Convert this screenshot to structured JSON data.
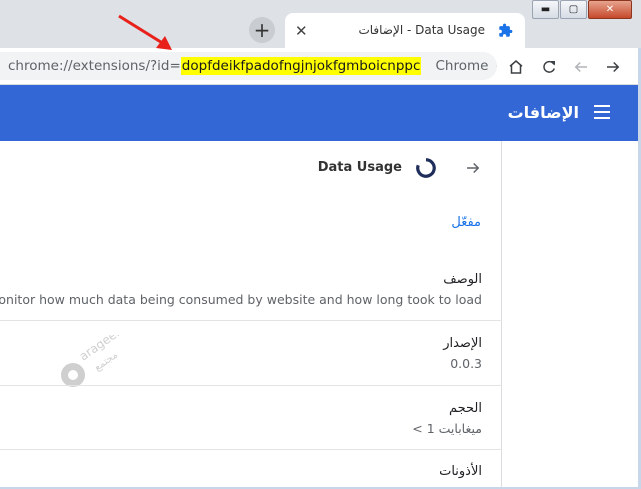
{
  "window": {
    "controls": {
      "minimize": "▬",
      "maximize": "▢",
      "close": "✕"
    }
  },
  "tabstrip": {
    "new_tab": "+",
    "tab": {
      "title": "الإضافات - Data Usage",
      "close": "✕",
      "icon": "puzzle-icon"
    }
  },
  "toolbar": {
    "url_prefix": "chrome://extensions/?id=",
    "url_id": "dopfdeikfpadofngjnjokfgmboicnppc",
    "chrome_label": "Chrome"
  },
  "header": {
    "title": "الإضافات"
  },
  "detail": {
    "name": "Data Usage",
    "enabled": "مفعّل",
    "sections": [
      {
        "label": "الوصف",
        "value": "Monitor how much data being consumed by website and how long took to load"
      },
      {
        "label": "الإصدار",
        "value": "0.0.3"
      },
      {
        "label": "الحجم",
        "value": "< 1 ميغابايت"
      },
      {
        "label": "الأذونات",
        "value": ""
      }
    ]
  },
  "watermark": {
    "text": "arageek",
    "sub": "مجتمع"
  },
  "colors": {
    "header": "#3367d6",
    "highlight": "#ffff00",
    "link": "#1a73e8"
  }
}
